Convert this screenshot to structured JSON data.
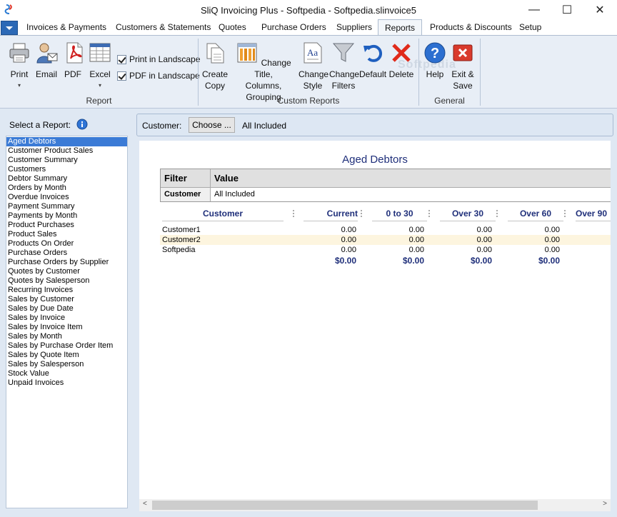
{
  "window": {
    "title": "SliQ Invoicing Plus - Softpedia - Softpedia.slinvoice5",
    "minimize": "—",
    "maximize": "☐",
    "close": "✕"
  },
  "menu": {
    "tabs": [
      "Invoices & Payments",
      "Customers & Statements",
      "Quotes",
      "Purchase Orders",
      "Suppliers",
      "Reports",
      "Products & Discounts",
      "Setup"
    ],
    "active": "Reports",
    "watermark": "Softpedia"
  },
  "ribbon": {
    "report_group": {
      "label": "Report",
      "print": "Print",
      "email": "Email",
      "pdf": "PDF",
      "excel": "Excel",
      "print_landscape": "Print in Landscape",
      "pdf_landscape": "PDF in Landscape"
    },
    "custom_group": {
      "label": "Custom Reports",
      "create_copy_1": "Create",
      "create_copy_2": "Copy",
      "change_title_1": "Change Title,",
      "change_title_2": "Columns, Grouping",
      "change_style_1": "Change",
      "change_style_2": "Style",
      "change_filters_1": "Change",
      "change_filters_2": "Filters",
      "default": "Default",
      "delete": "Delete"
    },
    "general_group": {
      "label": "General",
      "help": "Help",
      "exit_1": "Exit &",
      "exit_2": "Save"
    }
  },
  "left": {
    "select_label": "Select a Report:",
    "reports": [
      "Aged Debtors",
      "Customer Product Sales",
      "Customer Summary",
      "Customers",
      "Debtor Summary",
      "Orders by Month",
      "Overdue Invoices",
      "Payment Summary",
      "Payments by Month",
      "Product Purchases",
      "Product Sales",
      "Products On Order",
      "Purchase Orders",
      "Purchase Orders by Supplier",
      "Quotes by Customer",
      "Quotes by Salesperson",
      "Recurring Invoices",
      "Sales by Customer",
      "Sales by Due Date",
      "Sales by Invoice",
      "Sales by Invoice Item",
      "Sales by Month",
      "Sales by Purchase Order Item",
      "Sales by Quote Item",
      "Sales by Salesperson",
      "Stock Value",
      "Unpaid Invoices"
    ],
    "selected": "Aged Debtors"
  },
  "customer_bar": {
    "label": "Customer:",
    "choose": "Choose ...",
    "value": "All Included"
  },
  "report": {
    "title": "Aged Debtors",
    "filter_header": "Filter",
    "value_header": "Value",
    "filter_name": "Customer",
    "filter_value": "All Included",
    "columns": [
      "Customer",
      "Current",
      "0 to 30",
      "Over 30",
      "Over 60",
      "Over 90"
    ],
    "rows": [
      {
        "customer": "Customer1",
        "current": "0.00",
        "d0_30": "0.00",
        "over30": "0.00",
        "over60": "0.00"
      },
      {
        "customer": "Customer2",
        "current": "0.00",
        "d0_30": "0.00",
        "over30": "0.00",
        "over60": "0.00"
      },
      {
        "customer": "Softpedia",
        "current": "0.00",
        "d0_30": "0.00",
        "over30": "0.00",
        "over60": "0.00"
      }
    ],
    "totals": {
      "current": "$0.00",
      "d0_30": "$0.00",
      "over30": "$0.00",
      "over60": "$0.00"
    }
  }
}
